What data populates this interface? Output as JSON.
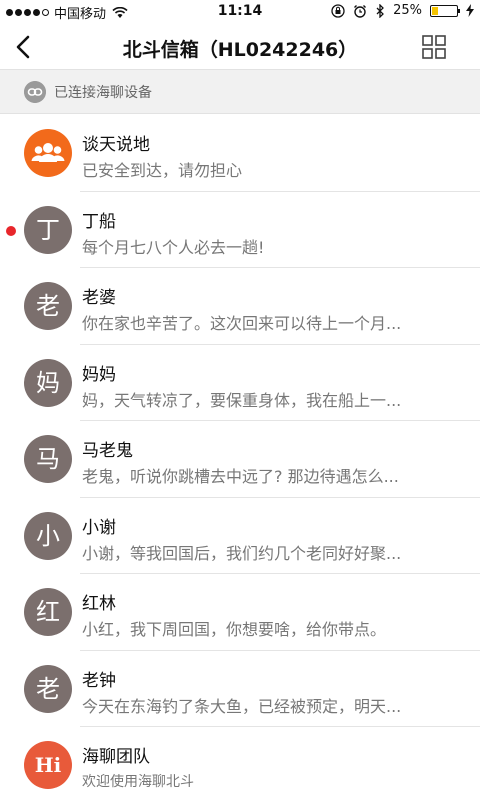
{
  "status": {
    "carrier": "中国移动",
    "time": "11:14",
    "battery": "25%",
    "battery_level": 0.25
  },
  "nav": {
    "title": "北斗信箱（HL0242246）"
  },
  "connection": {
    "text": "已连接海聊设备"
  },
  "conversations": [
    {
      "name": "谈天说地",
      "message": "已安全到达，请勿担心",
      "avatar_icon": "group-icon",
      "unread": false
    },
    {
      "name": "丁船",
      "message": "每个月七八个人必去一趟!",
      "avatar_text": "丁",
      "unread": true
    },
    {
      "name": "老婆",
      "message": "你在家也辛苦了。这次回来可以待上一个月...",
      "avatar_text": "老",
      "unread": false
    },
    {
      "name": "妈妈",
      "message": "妈，天气转凉了，要保重身体，我在船上一...",
      "avatar_text": "妈",
      "unread": false
    },
    {
      "name": "马老鬼",
      "message": "老鬼，听说你跳槽去中远了? 那边待遇怎么...",
      "avatar_text": "马",
      "unread": false
    },
    {
      "name": "小谢",
      "message": "小谢，等我回国后，我们约几个老同好好聚...",
      "avatar_text": "小",
      "unread": false
    },
    {
      "name": "红林",
      "message": "小红，我下周回国，你想要啥，给你带点。",
      "avatar_text": "红",
      "unread": false
    },
    {
      "name": "老钟",
      "message": "今天在东海钓了条大鱼，已经被预定，明天...",
      "avatar_text": "老",
      "unread": false
    },
    {
      "name": "海聊团队",
      "message": "欢迎使用海聊北斗",
      "avatar_text": "Hi",
      "unread": false
    }
  ]
}
